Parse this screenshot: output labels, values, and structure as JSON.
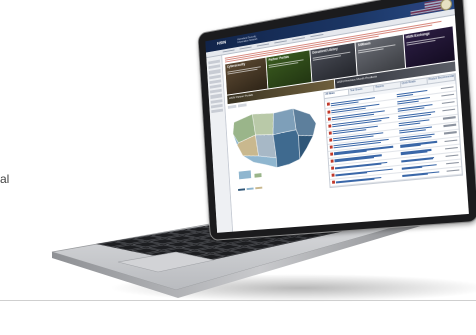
{
  "page": {
    "side_caption": "al"
  },
  "site": {
    "logo": "HSIN",
    "logo_sub": "Homeland Security Information Network",
    "tiles": [
      {
        "title": "Cybersecurity"
      },
      {
        "title": "Partner Portals"
      },
      {
        "title": "Document Library"
      },
      {
        "title": "SitRoom"
      },
      {
        "title": "HSIN Exchange"
      }
    ],
    "bands": [
      {
        "label": "HSIN Partner Portals"
      },
      {
        "label": "HSIN Previous Month Products"
      }
    ],
    "news_tabs": [
      "All News",
      "Tear Sheets",
      "Reports",
      "Quick Reads",
      "Product Recommendations"
    ]
  },
  "colors": {
    "header_navy": "#11244a",
    "alert_red": "#c0392b",
    "link_blue": "#3a67a8",
    "laptop_silver": "#c9cacd",
    "bezel_black": "#1b1b1d"
  },
  "icons": {
    "seal": "dhs-seal-icon",
    "flag": "us-flag-icon",
    "pdf": "pdf-file-icon",
    "trackpad": "trackpad"
  }
}
